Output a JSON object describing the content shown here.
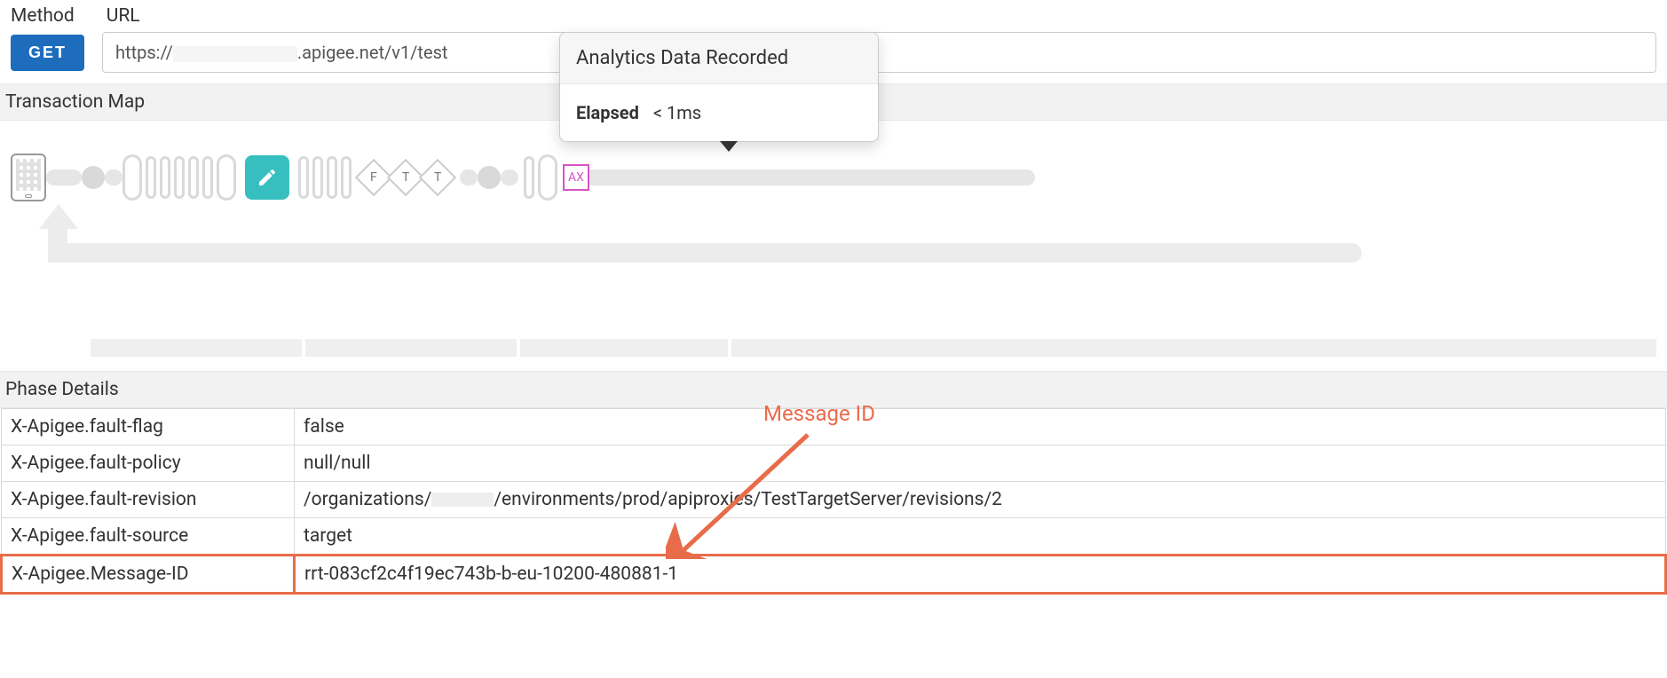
{
  "header": {
    "method_label": "Method",
    "url_label": "URL",
    "get_button": "GET",
    "url_prefix": "https://",
    "url_suffix": ".apigee.net/v1/test"
  },
  "sections": {
    "transaction_map": "Transaction Map",
    "phase_details": "Phase Details"
  },
  "tooltip": {
    "title": "Analytics Data Recorded",
    "elapsed_label": "Elapsed",
    "elapsed_value": "< 1ms"
  },
  "map_nodes": {
    "ax_label": "AX",
    "f_label": "F",
    "t1_label": "T",
    "t2_label": "T"
  },
  "phase_rows": [
    {
      "name": "X-Apigee.fault-flag",
      "value": "false"
    },
    {
      "name": "X-Apigee.fault-policy",
      "value": "null/null"
    },
    {
      "name": "X-Apigee.fault-revision",
      "value_prefix": "/organizations/",
      "value_suffix": "/environments/prod/apiproxies/TestTargetServer/revisions/2",
      "has_mask": true
    },
    {
      "name": "X-Apigee.fault-source",
      "value": "target"
    },
    {
      "name": "X-Apigee.Message-ID",
      "value": "rrt-083cf2c4f19ec743b-b-eu-10200-480881-1",
      "highlight": true
    }
  ],
  "annotation": {
    "label": "Message ID"
  }
}
